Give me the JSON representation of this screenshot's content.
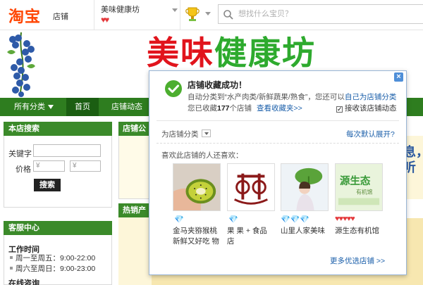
{
  "header": {
    "logo": "淘宝",
    "logo_sub": "店铺",
    "shop_name": "美味健康坊",
    "shop_rank": "♥♥",
    "search_placeholder": "想找什么宝贝？"
  },
  "banner": {
    "title_part1": "美味",
    "title_part2": "健康坊"
  },
  "nav": {
    "categories": "所有分类",
    "home": "首页",
    "dynamics": "店铺动态"
  },
  "left": {
    "search_title": "本店搜索",
    "keyword_label": "关键字",
    "price_label": "价格",
    "currency1": "¥",
    "currency2": "¥",
    "search_button": "搜索",
    "service_title": "客服中心",
    "work_time_title": "工作时间",
    "weekday": "周一至周五：9:00-22:00",
    "weekend": "周六至周日：9:00-23:00",
    "next_title": "在线咨询"
  },
  "center": {
    "notice_title": "店铺公告",
    "hot_title": "热销产品",
    "right_text": "息，听"
  },
  "popup": {
    "close": "×",
    "title": "店铺收藏成功！",
    "line1_prefix": "自动分类到",
    "line1_cat": "“水产肉类/新鲜蔬果/熟食”",
    "line1_mid": "，您还可以",
    "line1_link": "自己为店铺分类",
    "line2_prefix": "您已收藏",
    "line2_count": "177",
    "line2_unit": "个店铺",
    "line2_link": "查看收藏夹>>",
    "checkbox_label": "接收该店铺动态",
    "category_label": "为店铺分类",
    "expand_link": "每次默认展开?",
    "like_label": "喜欢此店铺的人还喜欢：",
    "shops": [
      {
        "rank": "💎",
        "name_line1": "金马夹猕猴桃",
        "name_line2": "新鲜又好吃 物"
      },
      {
        "rank": "💎",
        "name_line1": "果 果 + 食品",
        "name_line2": "店"
      },
      {
        "rank": "💎💎💎",
        "name_line1": "山里人家美味",
        "name_line2": ""
      },
      {
        "rank": "♥♥♥♥♥",
        "name_line1": "源生态有机馆",
        "name_line2": ""
      }
    ],
    "more_link": "更多优选店铺 >>"
  },
  "colors": {
    "accent_green": "#3b8a2a",
    "link_blue": "#1b5faa",
    "brand_orange": "#ff4400"
  }
}
